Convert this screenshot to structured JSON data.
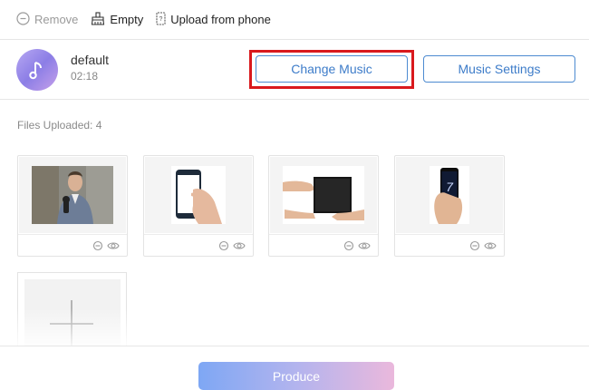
{
  "toolbar": {
    "remove_label": "Remove",
    "empty_label": "Empty",
    "upload_label": "Upload from phone"
  },
  "music": {
    "name": "default",
    "duration": "02:18",
    "change_label": "Change Music",
    "settings_label": "Music Settings"
  },
  "files": {
    "label": "Files Uploaded: 4",
    "items": [
      {
        "subject": "man-with-microphone-photo"
      },
      {
        "subject": "hand-holding-phone-photo"
      },
      {
        "subject": "hands-holding-tablet-photo"
      },
      {
        "subject": "hand-holding-phone-photo"
      }
    ]
  },
  "footer": {
    "produce_label": "Produce"
  },
  "colors": {
    "accent": "#3d7cc9",
    "highlight": "#d9191d",
    "produce_gradient": [
      "#7ea7f4",
      "#eab8dc"
    ]
  }
}
